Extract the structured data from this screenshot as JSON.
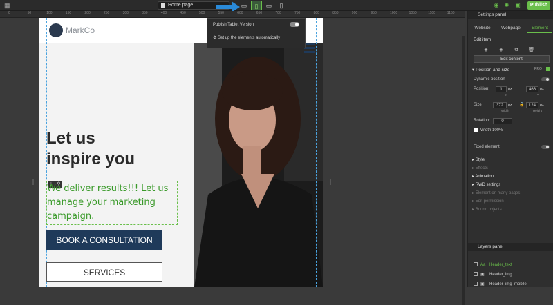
{
  "topbar": {
    "page_name": "Home page",
    "publish_label": "Publish"
  },
  "ruler": [
    "0",
    "50",
    "100",
    "150",
    "200",
    "250",
    "300",
    "350",
    "400",
    "450",
    "500",
    "550",
    "600",
    "650",
    "700",
    "750",
    "800",
    "850",
    "900",
    "950",
    "1000",
    "1050",
    "1100",
    "1150"
  ],
  "site": {
    "logo_text": "MarkCo",
    "headline_line1": "Let us",
    "headline_line2": "inspire you",
    "subtext": "We deliver results!!! Let us manage your marketing campaign.",
    "cta_label": "BOOK A CONSULTATION",
    "services_label": "SERVICES"
  },
  "dropdown": {
    "publish_tablet": "Publish Tablet Version",
    "setup_auto": "Set up the elements automatically"
  },
  "panel": {
    "title": "Settings panel",
    "tabs": [
      "Website",
      "Webpage",
      "Element"
    ],
    "edit_item": "Edit item",
    "edit_content": "Edit content",
    "position_size": "Position and size",
    "pro_badge": "PRO",
    "dynamic_position": "Dynamic position",
    "position_label": "Position:",
    "pos_x": "1",
    "pos_y": "466",
    "unit": "px",
    "x_label": "X",
    "y_label": "Y",
    "size_label": "Size:",
    "width_val": "372",
    "height_val": "124",
    "width_label": "Width",
    "height_label": "Height",
    "rotation_label": "Rotation:",
    "rotation_val": "0",
    "width100": "Width 100%",
    "fixed_element": "Fixed element",
    "sections": [
      "Style",
      "Effects",
      "Animation",
      "RWD settings",
      "Element on many pages",
      "Edit permission",
      "Bound objects"
    ],
    "layers_title": "Layers panel",
    "layers": [
      "Header_text",
      "Header_img",
      "Header_img_mobile"
    ]
  }
}
